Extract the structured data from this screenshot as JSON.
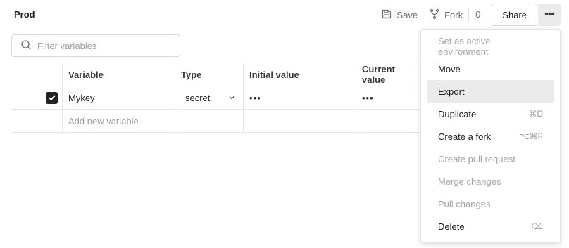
{
  "header": {
    "environment_name": "Prod",
    "save_label": "Save",
    "fork_label": "Fork",
    "fork_count": "0",
    "share_label": "Share"
  },
  "filter": {
    "placeholder": "Filter variables",
    "value": ""
  },
  "table": {
    "columns": [
      "Variable",
      "Type",
      "Initial value",
      "Current value"
    ],
    "rows": [
      {
        "enabled": true,
        "variable": "Mykey",
        "type": "secret",
        "initial_value": "•••",
        "current_value": "•••"
      }
    ],
    "add_placeholder": "Add new variable"
  },
  "menu": {
    "items": [
      {
        "label": "Set as active environment",
        "shortcut": "",
        "disabled": true
      },
      {
        "label": "Move",
        "shortcut": "",
        "disabled": false
      },
      {
        "label": "Export",
        "shortcut": "",
        "disabled": false,
        "highlighted": true
      },
      {
        "label": "Duplicate",
        "shortcut": "⌘D",
        "disabled": false
      },
      {
        "label": "Create a fork",
        "shortcut": "⌥⌘F",
        "disabled": false
      },
      {
        "label": "Create pull request",
        "shortcut": "",
        "disabled": true
      },
      {
        "label": "Merge changes",
        "shortcut": "",
        "disabled": true
      },
      {
        "label": "Pull changes",
        "shortcut": "",
        "disabled": true
      },
      {
        "label": "Delete",
        "shortcut": "⌫",
        "disabled": false
      }
    ]
  },
  "icons": {
    "save": "save-icon",
    "fork": "fork-icon",
    "more": "more-horizontal-icon",
    "search": "search-icon",
    "check": "check-icon",
    "chevron": "chevron-down-icon",
    "backspace": "backspace-icon"
  },
  "colors": {
    "text": "#212121",
    "muted": "#6b6b6b",
    "disabled": "#a6a6a6",
    "hover_bg": "#ebebeb",
    "border": "#e6e6e6"
  }
}
